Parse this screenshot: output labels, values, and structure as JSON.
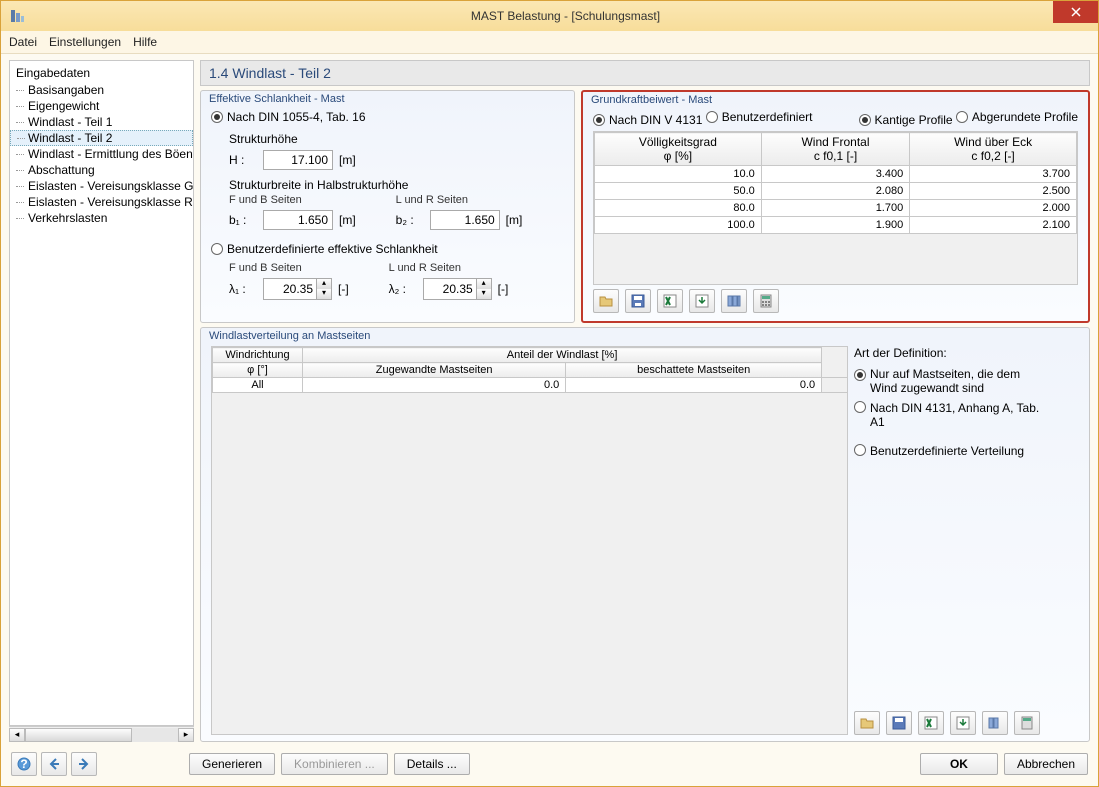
{
  "window": {
    "title": "MAST Belastung - [Schulungsmast]"
  },
  "menu": {
    "file": "Datei",
    "settings": "Einstellungen",
    "help": "Hilfe"
  },
  "sidebar": {
    "root": "Eingabedaten",
    "items": [
      "Basisangaben",
      "Eigengewicht",
      "Windlast - Teil 1",
      "Windlast - Teil 2",
      "Windlast - Ermittlung des Böenr",
      "Abschattung",
      "Eislasten - Vereisungsklasse G",
      "Eislasten - Vereisungsklasse R",
      "Verkehrslasten"
    ],
    "selected_index": 3
  },
  "page_title": "1.4 Windlast - Teil 2",
  "slank": {
    "legend": "Effektive Schlankheit - Mast",
    "opt_din": "Nach DIN 1055-4, Tab. 16",
    "strukturhoehe": "Strukturhöhe",
    "H_label": "H :",
    "H_value": "17.100",
    "m_unit": "[m]",
    "strukturbreite": "Strukturbreite in Halbstrukturhöhe",
    "fb_seiten": "F und B Seiten",
    "lr_seiten": "L und R Seiten",
    "b1_label": "b₁ :",
    "b1_value": "1.650",
    "b2_label": "b₂ :",
    "b2_value": "1.650",
    "opt_user": "Benutzerdefinierte effektive Schlankheit",
    "l1_label": "λ₁ :",
    "l1_value": "20.35",
    "l2_label": "λ₂ :",
    "l2_value": "20.35",
    "dash_unit": "[-]"
  },
  "grund": {
    "legend": "Grundkraftbeiwert - Mast",
    "opt_din": "Nach DIN V 4131",
    "opt_user": "Benutzerdefiniert",
    "opt_kantig": "Kantige Profile",
    "opt_rund": "Abgerundete Profile",
    "headers": {
      "h1a": "Völligkeitsgrad",
      "h1b": "φ [%]",
      "h2a": "Wind Frontal",
      "h2b": "c f0,1 [-]",
      "h3a": "Wind über Eck",
      "h3b": "c f0,2 [-]"
    },
    "rows": [
      {
        "phi": "10.0",
        "c1": "3.400",
        "c2": "3.700"
      },
      {
        "phi": "50.0",
        "c1": "2.080",
        "c2": "2.500"
      },
      {
        "phi": "80.0",
        "c1": "1.700",
        "c2": "2.000"
      },
      {
        "phi": "100.0",
        "c1": "1.900",
        "c2": "2.100"
      }
    ]
  },
  "wind_dist": {
    "legend": "Windlastverteilung an Mastseiten",
    "hdr_dir": "Windrichtung",
    "hdr_phi": "φ [°]",
    "hdr_anteil": "Anteil der Windlast [%]",
    "hdr_zugewandte": "Zugewandte Mastseiten",
    "hdr_beschattete": "beschattete Mastseiten",
    "row": {
      "dir": "All",
      "zug": "0.0",
      "bes": "0.0"
    }
  },
  "def": {
    "title": "Art der Definition:",
    "opt1": "Nur auf Mastseiten, die dem Wind zugewandt sind",
    "opt2": "Nach DIN 4131, Anhang A, Tab. A1",
    "opt3": "Benutzerdefinierte Verteilung"
  },
  "buttons": {
    "generate": "Generieren",
    "combine": "Kombinieren ...",
    "details": "Details ...",
    "ok": "OK",
    "cancel": "Abbrechen"
  }
}
